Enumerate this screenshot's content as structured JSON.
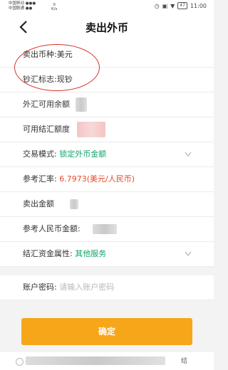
{
  "status_bar": {
    "carrier1": "中国移动 ●●●",
    "carrier2": "中国联通 ●●",
    "speed_value": "0",
    "speed_unit": "K/s",
    "battery": "47",
    "time": "11:00"
  },
  "header": {
    "title": "卖出外币",
    "back_icon": "chevron-left-icon"
  },
  "form": {
    "currency": {
      "label": "卖出币种:",
      "value": "美元"
    },
    "cash_flag": {
      "label": "钞汇标志:",
      "value": "现钞"
    },
    "fx_balance": {
      "label": "外汇可用余额"
    },
    "settle_quota": {
      "label": "可用结汇额度"
    },
    "trade_mode": {
      "label": "交易模式:",
      "value": "锁定外币金额"
    },
    "ref_rate": {
      "label": "参考汇率:",
      "value": "6.7973(美元/人民币)"
    },
    "sell_amount": {
      "label": "卖出金额"
    },
    "ref_cny": {
      "label": "参考人民币金额:"
    },
    "fund_attr": {
      "label": "结汇资金属性:",
      "value": "其他服务"
    },
    "password": {
      "label": "账户密码:",
      "placeholder": "请输入账户密码"
    }
  },
  "confirm_button": {
    "label": "确定"
  },
  "footer": {
    "tail": "结"
  },
  "colors": {
    "accent": "#f7a619",
    "green": "#13a56b",
    "red": "#e64a28",
    "annotation": "#d9342b"
  }
}
